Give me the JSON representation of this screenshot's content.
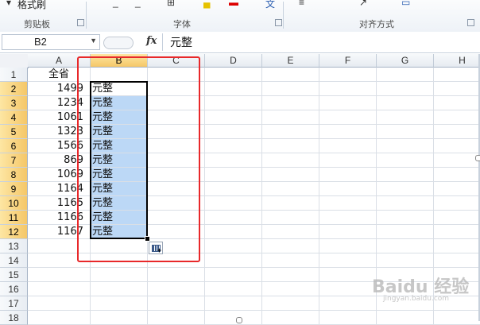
{
  "ribbon": {
    "format_painter": "格式刷",
    "groups": {
      "clipboard": "剪贴板",
      "font": "字体",
      "alignment": "对齐方式"
    }
  },
  "formula_bar": {
    "name_box": "B2",
    "fx": "fx",
    "content": "元整"
  },
  "columns": [
    "A",
    "B",
    "C",
    "D",
    "E",
    "F",
    "G",
    "H"
  ],
  "rows": [
    "1",
    "2",
    "3",
    "4",
    "5",
    "6",
    "7",
    "8",
    "9",
    "10",
    "11",
    "12",
    "13",
    "14",
    "15",
    "16",
    "17",
    "18"
  ],
  "colA": [
    "全省",
    "1499",
    "1234",
    "1061",
    "1323",
    "1566",
    "869",
    "1069",
    "1164",
    "1165",
    "1166",
    "1167"
  ],
  "colB": [
    "",
    "元整",
    "元整",
    "元整",
    "元整",
    "元整",
    "元整",
    "元整",
    "元整",
    "元整",
    "元整",
    "元整"
  ],
  "colors": {
    "selection": "#bcd8f6",
    "annotation": "#e8282a",
    "active_header": "#f5c768"
  },
  "watermark": {
    "main": "Baidu 经验",
    "sub": "jingyan.baidu.com"
  }
}
